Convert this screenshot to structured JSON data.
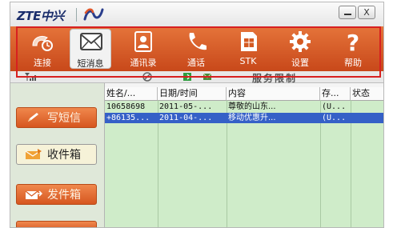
{
  "window": {
    "brand": "ZTE中兴",
    "minimize_glyph": "—",
    "close_glyph": "X"
  },
  "toolbar": {
    "items": [
      {
        "label": "连接",
        "icon": "connect-icon",
        "active": false
      },
      {
        "label": "短消息",
        "icon": "envelope-icon",
        "active": true
      },
      {
        "label": "通讯录",
        "icon": "contacts-icon",
        "active": false
      },
      {
        "label": "通话",
        "icon": "phone-icon",
        "active": false
      },
      {
        "label": "STK",
        "icon": "sim-card-icon",
        "active": false
      },
      {
        "label": "设置",
        "icon": "gear-icon",
        "active": false
      },
      {
        "label": "帮助",
        "icon": "help-icon",
        "active": false
      }
    ]
  },
  "status": {
    "service_text": "服务限制"
  },
  "sidebar": {
    "items": [
      {
        "label": "写短信",
        "icon": "pencil-icon"
      },
      {
        "label": "收件箱",
        "icon": "inbox-icon"
      },
      {
        "label": "发件箱",
        "icon": "outbox-icon"
      }
    ]
  },
  "message_list": {
    "columns": [
      "姓名/...",
      "日期/时间",
      "内容",
      "存...",
      "状态"
    ],
    "rows": [
      {
        "name": "10658698",
        "date": "2011-05-...",
        "content": "尊敬的山东...",
        "storage": "(U...",
        "state": "",
        "selected": false
      },
      {
        "name": "+86135...",
        "date": "2011-04-...",
        "content": "移动优惠升...",
        "storage": "(U...",
        "state": "",
        "selected": true
      }
    ]
  },
  "colors": {
    "toolbar_orange": "#d45a22",
    "toolbar_outline": "#d72020",
    "list_bg": "#cfecc9",
    "selection": "#3560c7",
    "brand_blue": "#1a2d6b"
  }
}
